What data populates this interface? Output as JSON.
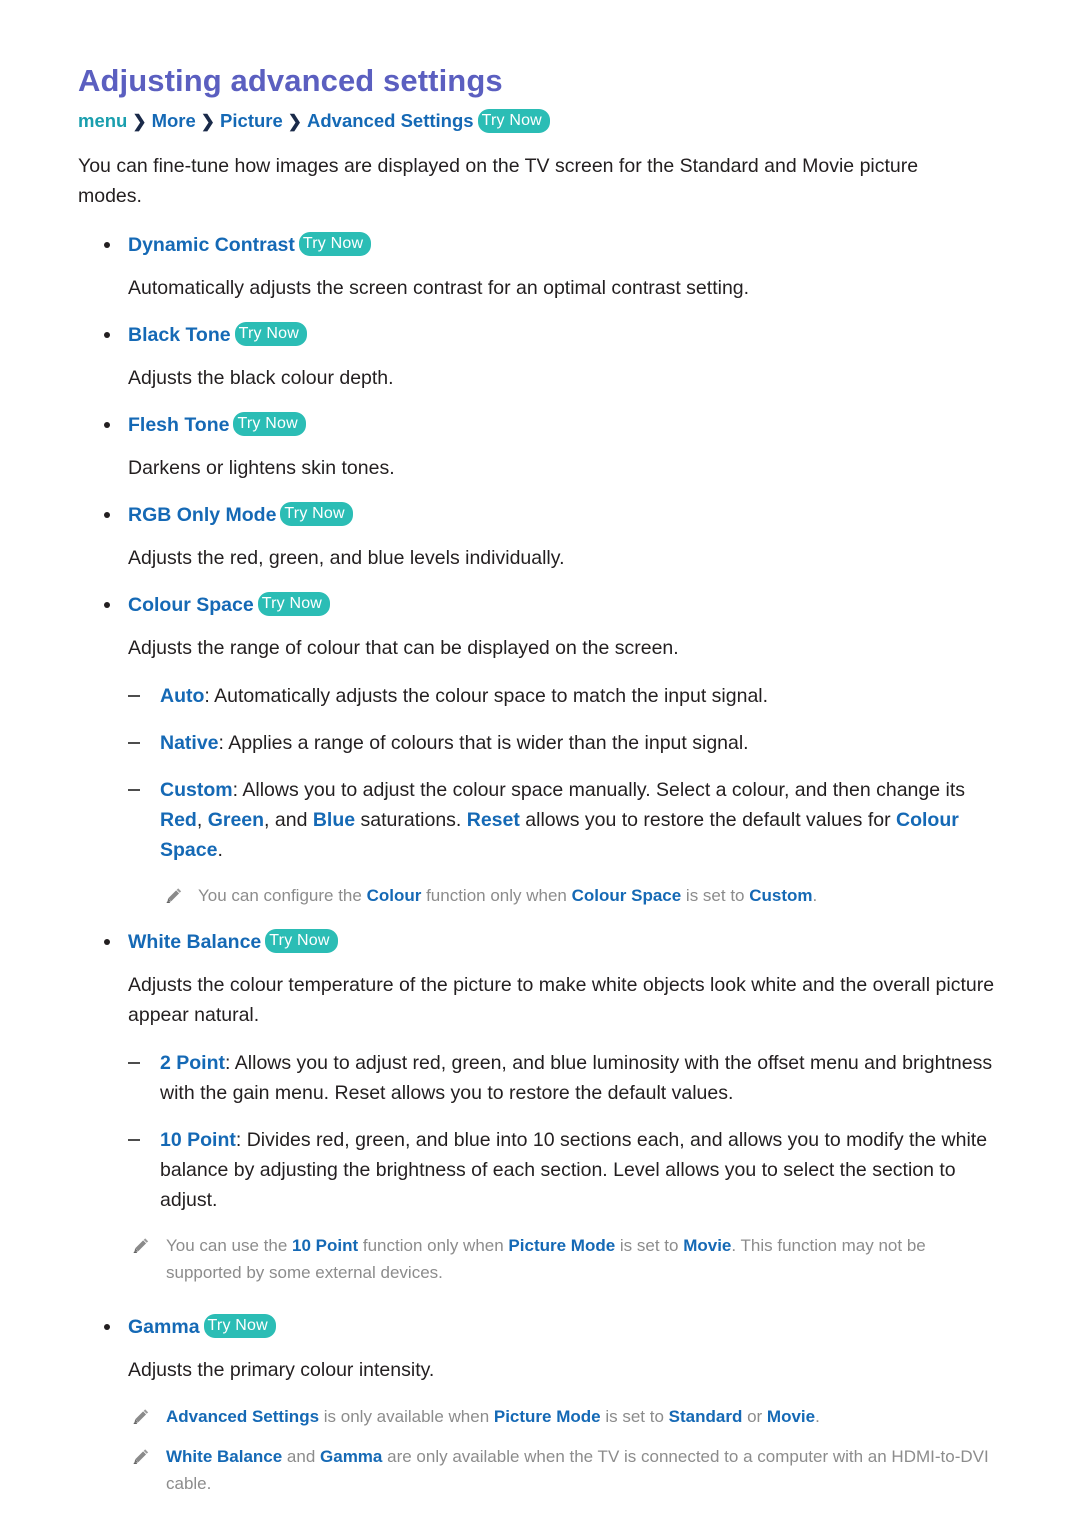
{
  "title": "Adjusting advanced settings",
  "breadcrumb": {
    "root": "menu",
    "separator": "❯",
    "items": [
      "More",
      "Picture",
      "Advanced Settings"
    ],
    "try_now": "Try Now"
  },
  "intro": "You can fine-tune how images are displayed on the TV screen for the Standard and Movie picture modes.",
  "try_now_label": "Try Now",
  "sections": [
    {
      "label": "Dynamic Contrast",
      "try_now": "Try Now",
      "description": "Automatically adjusts the screen contrast for an optimal contrast setting."
    },
    {
      "label": "Black Tone",
      "try_now": "Try Now",
      "description": "Adjusts the black colour depth."
    },
    {
      "label": "Flesh Tone",
      "try_now": "Try Now",
      "description": "Darkens or lightens skin tones."
    },
    {
      "label": "RGB Only Mode",
      "try_now": "Try Now",
      "description": "Adjusts the red, green, and blue levels individually."
    },
    {
      "label": "Colour Space",
      "try_now": "Try Now",
      "description": "Adjusts the range of colour that can be displayed on the screen."
    },
    {
      "label": "White Balance",
      "try_now": "Try Now",
      "description": "Adjusts the colour temperature of the picture to make white objects look white and the overall picture appear natural."
    },
    {
      "label": "Gamma",
      "try_now": "Try Now",
      "description": "Adjusts the primary colour intensity."
    }
  ],
  "colour_space_options": {
    "auto": {
      "term": "Auto",
      "text": ": Automatically adjusts the colour space to match the input signal."
    },
    "native": {
      "term": "Native",
      "text": ": Applies a range of colours that is wider than the input signal."
    },
    "custom": {
      "term": "Custom",
      "t1": ": Allows you to adjust the colour space manually. Select a colour, and then change its ",
      "red": "Red",
      "t2": ", ",
      "green": "Green",
      "t3": ", and ",
      "blue": "Blue",
      "t4": " saturations. ",
      "reset": "Reset",
      "t5": " allows you to restore the default values for ",
      "colour_space": "Colour Space",
      "t6": "."
    }
  },
  "colour_space_note": {
    "t1": "You can configure the ",
    "k1": "Colour",
    "t2": " function only when ",
    "k2": "Colour Space",
    "t3": " is set to ",
    "k3": "Custom",
    "t4": "."
  },
  "white_balance_options": {
    "two_point": {
      "term": "2 Point",
      "text": ": Allows you to adjust red, green, and blue luminosity with the offset menu and brightness with the gain menu. Reset allows you to restore the default values."
    },
    "ten_point": {
      "term": "10 Point",
      "text": ": Divides red, green, and blue into 10 sections each, and allows you to modify the white balance by adjusting the brightness of each section. Level allows you to select the section to adjust."
    }
  },
  "ten_point_note": {
    "t1": "You can use the ",
    "k1": "10 Point",
    "t2": " function only when ",
    "k2": "Picture Mode",
    "t3": " is set to ",
    "k3": "Movie",
    "t4": ". This function may not be supported by some external devices."
  },
  "final_notes": {
    "note1": {
      "k1": "Advanced Settings",
      "t1": " is only available when ",
      "k2": "Picture Mode",
      "t2": " is set to ",
      "k3": "Standard",
      "t3": " or ",
      "k4": "Movie",
      "t4": "."
    },
    "note2": {
      "k1": "White Balance",
      "t1": " and ",
      "k2": "Gamma",
      "t2": " are only available when the TV is connected to a computer with an HDMI-to-DVI cable."
    }
  },
  "colors": {
    "title": "#5B5FC0",
    "link_blue": "#1569B5",
    "menu_teal": "#1A9FAE",
    "badge_teal": "#2BBDB5",
    "note_grey": "#8C8C8C",
    "body": "#231F20"
  },
  "icons": {
    "pencil": "pencil-icon",
    "chevron": "chevron-right-icon",
    "bullet": "bullet-dot-icon",
    "dash": "dash-icon"
  }
}
